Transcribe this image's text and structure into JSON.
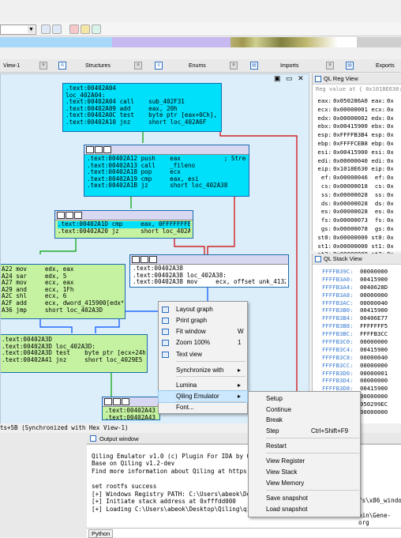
{
  "toolbar": {
    "segment_combo": ""
  },
  "tabs": [
    {
      "label": "View-1"
    },
    {
      "label": "Structures"
    },
    {
      "label": "Enums"
    },
    {
      "label": "Imports"
    },
    {
      "label": "Exports"
    }
  ],
  "graph": {
    "node1": {
      "lines": [
        ".text:00402A04",
        "loc_402A04:",
        ".text:00402A04 call    sub_402F31",
        ".text:00402A09 add     eax, 20h",
        ".text:00402A0C test    byte ptr [eax+0Ch], 40h",
        ".text:00402A10 jnz     short loc_402A6F"
      ]
    },
    "node2": {
      "lines": [
        ".text:00402A12 push    eax            ; Stream",
        ".text:00402A13 call    _fileno",
        ".text:00402A18 pop     ecx",
        ".text:00402A19 cmp     eax, esi",
        ".text:00402A1B jz      short loc_402A38"
      ]
    },
    "node3": {
      "lines": [
        ".text:00402A1D cmp     eax, 0FFFFFFFEh",
        ".text:00402A20 jz      short loc_402A38"
      ]
    },
    "node4": {
      "lines": [
        "A22 mov     edx, eax",
        "A24 sar     edx, 5",
        "A27 mov     ecx, eax",
        "A29 and     ecx, 1Fh",
        "A2C shl     ecx, 6",
        "A2F add     ecx, dword_415900[edx*4]",
        "A36 jmp     short loc_402A3D"
      ]
    },
    "node5": {
      "lines": [
        ".text:00402A38",
        ".text:00402A38 loc_402A38:",
        ".text:00402A38 mov     ecx, offset unk_413290"
      ]
    },
    "node6": {
      "lines": [
        ".text:00402A3D",
        ".text:00402A3D loc_402A3D:",
        ".text:00402A3D test    byte ptr [ecx+24h], 7Fh",
        ".text:00402A41 jnz     short loc_4029E5"
      ]
    },
    "node7": {
      "lines": [
        ".text:00402A43",
        ".text:00402A43"
      ]
    }
  },
  "status_text": "ts+5B (Synchronized with Hex View-1)",
  "reg_panel": {
    "title": "QL Reg View",
    "hint": "Reg value at { 0x1018E630:",
    "rows": [
      [
        "eax:",
        "0x050286A0",
        "eax:",
        "0x"
      ],
      [
        "ecx:",
        "0x00000001",
        "ecx:",
        "0x"
      ],
      [
        "edx:",
        "0x00000002",
        "edx:",
        "0x"
      ],
      [
        "ebx:",
        "0x00415900",
        "ebx:",
        "0x"
      ],
      [
        "esp:",
        "0xFFFFB3B4",
        "esp:",
        "0x"
      ],
      [
        "ebp:",
        "0xFFFFCEB8",
        "ebp:",
        "0x"
      ],
      [
        "esi:",
        "0x00415900",
        "esi:",
        "0x"
      ],
      [
        "edi:",
        "0x00000040",
        "edi:",
        "0x"
      ],
      [
        "eip:",
        "0x1018E630",
        "eip:",
        "0x"
      ],
      [
        "ef:",
        "0x00000046",
        "ef:",
        "0x"
      ],
      [
        "cs:",
        "0x00000018",
        "cs:",
        "0x"
      ],
      [
        "ss:",
        "0x00000028",
        "ss:",
        "0x"
      ],
      [
        "ds:",
        "0x00000028",
        "ds:",
        "0x"
      ],
      [
        "es:",
        "0x00000028",
        "es:",
        "0x"
      ],
      [
        "fs:",
        "0x00000073",
        "fs:",
        "0x"
      ],
      [
        "gs:",
        "0x00000078",
        "gs:",
        "0x"
      ],
      [
        "st0:",
        "0x00000000",
        "st0:",
        "0x"
      ],
      [
        "st1:",
        "0x00000000",
        "st1:",
        "0x"
      ],
      [
        "st2:",
        "0x00000000",
        "st2:",
        "0x"
      ]
    ]
  },
  "stack_panel": {
    "title": "QL Stack View",
    "rows": [
      [
        "FFFFB39C:",
        "00000000"
      ],
      [
        "FFFFB3A0:",
        "00415900"
      ],
      [
        "FFFFB3A4:",
        "0040628D"
      ],
      [
        "FFFFB3A8:",
        "00000000"
      ],
      [
        "FFFFB3AC:",
        "00000040"
      ],
      [
        "FFFFB3B0:",
        "00415900"
      ],
      [
        "FFFFB3B4:",
        "00406E77"
      ],
      [
        "FFFFB3B8:",
        "FFFFFFF5"
      ],
      [
        "FFFFB3BC:",
        "FFFFB3CC"
      ],
      [
        "FFFFB3C0:",
        "00000000"
      ],
      [
        "FFFFB3C4:",
        "00415900"
      ],
      [
        "FFFFB3C8:",
        "00000040"
      ],
      [
        "FFFFB3CC:",
        "00000000"
      ],
      [
        "FFFFB3D0:",
        "00000001"
      ],
      [
        "FFFFB3D4:",
        "00000000"
      ],
      [
        "FFFFB3D8:",
        "00415900"
      ],
      [
        "FFFFB3DC:",
        "00000000"
      ],
      [
        "FFFFB3E0:",
        "050299EC"
      ],
      [
        "FFFFB3E4:",
        "00000000"
      ]
    ]
  },
  "output": {
    "title": "Output window",
    "lines": [
      "",
      "Qiling Emulator v1.0 (c) Plugin For IDA by Qi",
      "Base on Qiling v1.2-dev",
      "Find more information about Qiling at https:/",
      "",
      "set rootfs success",
      "[+] Windows Registry PATH: C:\\Users\\abeok\\Des",
      "[+] Initiate stack address at 0xfffdd000",
      "[+] Loading C:\\Users\\abeok\\Desktop\\Qiling\\qil"
    ],
    "right_fragment_1": "fs\\x86_window",
    "right_fragment_2": "bin\\Gene-org",
    "input_label": "Python"
  },
  "context_menu": {
    "items": [
      {
        "label": "Layout graph",
        "key": "",
        "icon": "layout-graph-icon"
      },
      {
        "label": "Print graph",
        "key": "",
        "icon": "print-graph-icon"
      },
      {
        "label": "Fit window",
        "key": "W",
        "icon": "fit-window-icon"
      },
      {
        "label": "Zoom 100%",
        "key": "1",
        "icon": "zoom-icon"
      },
      {
        "label": "Text view",
        "key": "",
        "icon": "text-view-icon"
      },
      {
        "label": "Synchronize with",
        "key": "▸",
        "icon": ""
      },
      {
        "label": "Lumina",
        "key": "▸",
        "icon": ""
      },
      {
        "label": "Qiling Emulator",
        "key": "▸",
        "icon": ""
      },
      {
        "label": "Font...",
        "key": "",
        "icon": ""
      }
    ]
  },
  "submenu": {
    "items": [
      {
        "label": "Setup",
        "key": ""
      },
      {
        "label": "Continue",
        "key": ""
      },
      {
        "label": "Break",
        "key": ""
      },
      {
        "label": "Step",
        "key": "Ctrl+Shift+F9"
      },
      {
        "label": "Restart",
        "key": ""
      },
      {
        "label": "View Register",
        "key": ""
      },
      {
        "label": "View Stack",
        "key": ""
      },
      {
        "label": "View Memory",
        "key": ""
      },
      {
        "label": "Save snapshot",
        "key": ""
      },
      {
        "label": "Load snapshot",
        "key": ""
      }
    ]
  },
  "colors": {
    "accent": "#cce8ff",
    "node_cyan": "#00e0fa",
    "node_green": "#c4f2a0",
    "graph_bg": "#dbeefa",
    "edge_green": "#00a000",
    "edge_red": "#d00000",
    "edge_blue": "#0050ff"
  }
}
